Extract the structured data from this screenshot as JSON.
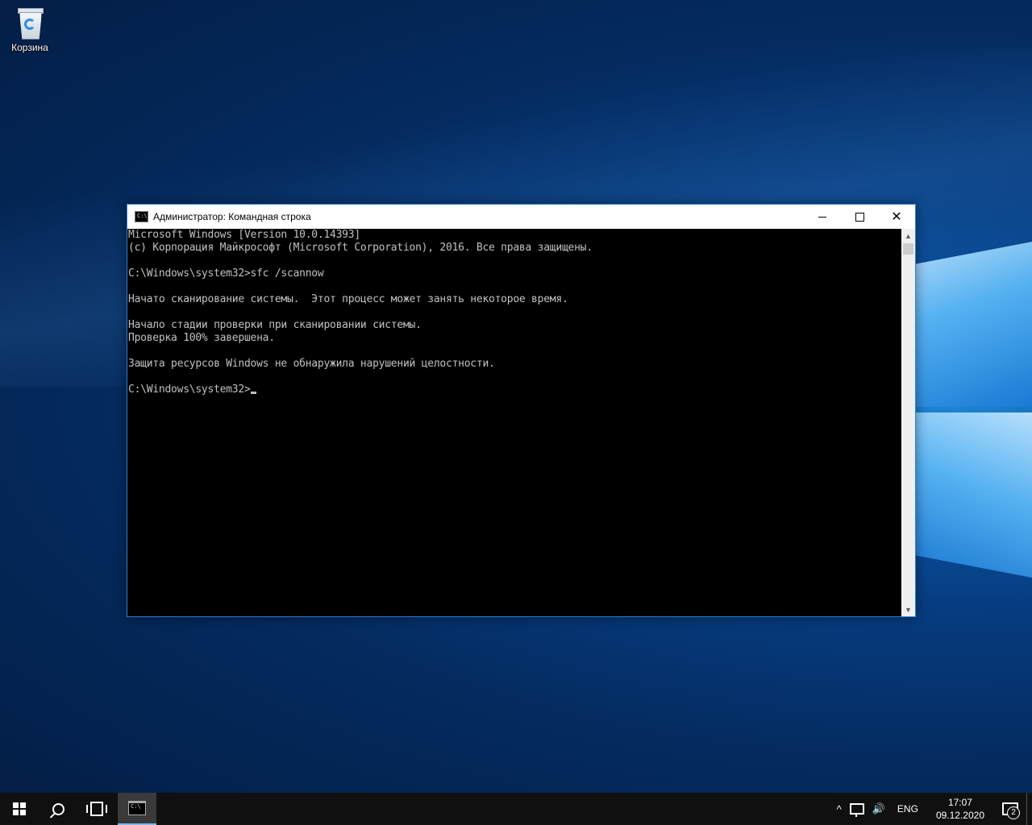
{
  "desktop": {
    "icons": [
      {
        "label": "Корзина",
        "icon": "recycle-bin-icon"
      }
    ]
  },
  "window": {
    "title": "Администратор: Командная строка",
    "icon": "cmd-icon",
    "controls": {
      "minimize": "minimize-icon",
      "maximize": "maximize-icon",
      "close": "✕"
    },
    "console_lines": [
      "Microsoft Windows [Version 10.0.14393]",
      "(c) Корпорация Майкрософт (Microsoft Corporation), 2016. Все права защищены.",
      "",
      "C:\\Windows\\system32>sfc /scannow",
      "",
      "Начато сканирование системы.  Этот процесс может занять некоторое время.",
      "",
      "Начало стадии проверки при сканировании системы.",
      "Проверка 100% завершена.",
      "",
      "Защита ресурсов Windows не обнаружила нарушений целостности.",
      "",
      "C:\\Windows\\system32>"
    ],
    "scrollbar": {
      "up": "▲",
      "down": "▼"
    }
  },
  "taskbar": {
    "start_icon": "windows-logo-icon",
    "search_icon": "search-icon",
    "task_view_icon": "task-view-icon",
    "pinned": [
      {
        "name": "cmd",
        "active": true
      }
    ],
    "tray": {
      "chevron": "^",
      "network_icon": "network-icon",
      "volume": "🔊",
      "language": "ENG",
      "time": "17:07",
      "date": "09.12.2020",
      "notifications_count": "2"
    }
  }
}
